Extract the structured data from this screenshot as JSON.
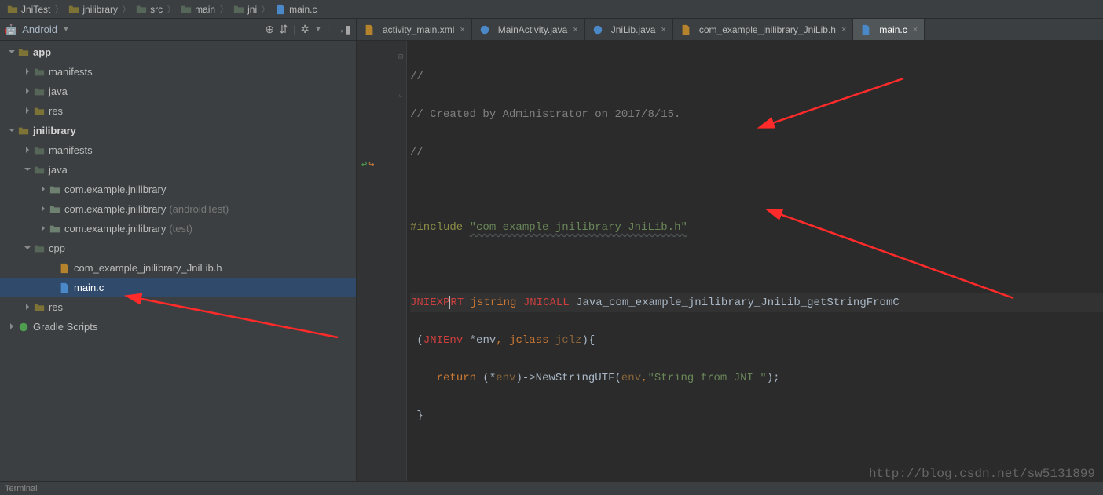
{
  "breadcrumbs": [
    "JniTest",
    "jnilibrary",
    "src",
    "main",
    "jni",
    "main.c"
  ],
  "moduleSelector": {
    "label": "Android"
  },
  "tree": {
    "app": {
      "label": "app",
      "children": {
        "manifests": "manifests",
        "java": "java",
        "res": "res"
      }
    },
    "jnilibrary": {
      "label": "jnilibrary",
      "children": {
        "manifests": "manifests",
        "java": {
          "label": "java",
          "pkg1": "com.example.jnilibrary",
          "pkg2": {
            "name": "com.example.jnilibrary",
            "suffix": "(androidTest)"
          },
          "pkg3": {
            "name": "com.example.jnilibrary",
            "suffix": "(test)"
          }
        },
        "cpp": {
          "label": "cpp",
          "h": "com_example_jnilibrary_JniLib.h",
          "c": "main.c"
        },
        "res": "res"
      }
    },
    "gradle": "Gradle Scripts"
  },
  "tabs": [
    {
      "label": "activity_main.xml",
      "icon": "xml"
    },
    {
      "label": "MainActivity.java",
      "icon": "java"
    },
    {
      "label": "JniLib.java",
      "icon": "java"
    },
    {
      "label": "com_example_jnilibrary_JniLib.h",
      "icon": "h"
    },
    {
      "label": "main.c",
      "icon": "c",
      "active": true
    }
  ],
  "code": {
    "l1": "//",
    "l2a": "// Created by Administrator on 2017/8/15.",
    "l3": "//",
    "l5a": "#include ",
    "l5b": "\"com_example_jnilibrary_JniLib.h\"",
    "l7_jniexport": "JNIEXP",
    "l7_jniexport2": "RT",
    "l7_jstring": "jstring",
    "l7_jnicall": "JNICALL",
    "l7_fn": "Java_com_example_jnilibrary_JniLib_getStringFromC",
    "l8_open": " (",
    "l8_env_t": "JNIEnv",
    "l8_env_v": " *env",
    "l8_comma": ", ",
    "l8_cls_t": "jclass",
    "l8_cls_v": " jclz",
    "l8_close": "){",
    "l9_indent": "    ",
    "l9_ret": "return",
    "l9_a": " (*",
    "l9_env": "env",
    "l9_b": ")->NewStringUTF(",
    "l9_env2": "env",
    "l9_c": ",",
    "l9_str": "\"String from JNI \"",
    "l9_d": ");",
    "l10": " }"
  },
  "status": {
    "left": "Terminal"
  },
  "watermark": "http://blog.csdn.net/sw5131899"
}
